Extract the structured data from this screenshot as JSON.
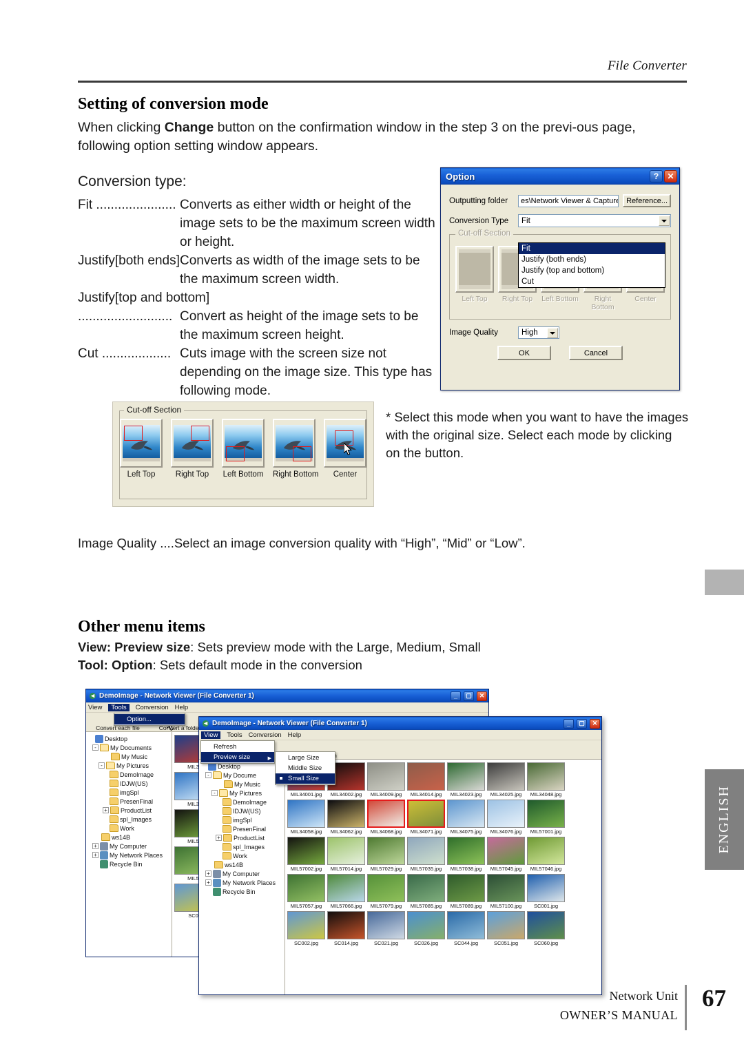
{
  "page": {
    "running_head": "File Converter",
    "footer_network": "Network Unit",
    "footer_manual": "OWNER’S MANUAL",
    "page_number": "67",
    "language_tab": "ENGLISH"
  },
  "section1": {
    "heading": "Setting of conversion mode",
    "intro_before": "When clicking ",
    "intro_bold": "Change",
    "intro_after": " button on the confirmation window in the step 3 on the previ-ous page, following option setting window appears.",
    "conversion_type_label": "Conversion type:",
    "entries": [
      {
        "term": "Fit ......................",
        "desc": "Converts as either width or height of the image  sets to be the maximum screen width or height."
      },
      {
        "term": "Justify[both ends]....",
        "desc": "Converts as width of the image sets to be the maximum screen width."
      },
      {
        "term": "Justify[top and bottom]",
        "desc": ""
      },
      {
        "term": " ..........................",
        "desc": "Convert as height of the image sets to be the maximum screen height."
      },
      {
        "term": "Cut ...................",
        "desc": "Cuts image with the screen size not depending on the image size. This type has following mode."
      }
    ],
    "note": "* Select this mode when you want to have the images with the original size. Select each mode by clicking on the button.",
    "image_quality_line": "Image Quality ....Select an image conversion quality with “High”, “Mid” or “Low”."
  },
  "section2": {
    "heading": "Other menu items",
    "line1_bold_a": "View: Preview size",
    "line1_rest": ": Sets preview mode with the Large, Medium, Small",
    "line2_bold_a": "Tool: Option",
    "line2_rest": ": Sets default mode in the conversion"
  },
  "option_dialog": {
    "title": "Option",
    "help_glyph": "?",
    "close_glyph": "✕",
    "output_folder_label": "Outputting folder",
    "output_folder_value": "es\\Network Viewer & Capture",
    "reference_button": "Reference...",
    "conversion_type_label": "Conversion Type",
    "conversion_type_value": "Fit",
    "conversion_options": [
      "Fit",
      "Justify (both ends)",
      "Justify (top and bottom)",
      "Cut"
    ],
    "conversion_selected_index": 0,
    "cutoff_legend": "Cut-off Section",
    "cutoff_captions": [
      "Left Top",
      "Right Top",
      "Left Bottom",
      "Right Bottom",
      "Center"
    ],
    "image_quality_label": "Image Quality",
    "image_quality_value": "High",
    "image_quality_options": [
      "High",
      "Mid",
      "Low"
    ],
    "ok_button": "OK",
    "cancel_button": "Cancel"
  },
  "cutoff_panel": {
    "legend": "Cut-off Section",
    "captions": [
      "Left Top",
      "Right Top",
      "Left Bottom",
      "Right Bottom",
      "Center"
    ]
  },
  "back_window": {
    "title": "DemoImage - Network Viewer (File Converter 1)",
    "menus": [
      "View",
      "Tools",
      "Conversion",
      "Help"
    ],
    "active_menu": "Tools",
    "menu_popup": [
      "Option..."
    ],
    "toolbar_labels": [
      "Convert each file",
      "Convert a folder"
    ],
    "tree": [
      {
        "label": "Desktop",
        "indent": 0,
        "expander": "",
        "icon": "desktop-icon"
      },
      {
        "label": "My Documents",
        "indent": 1,
        "expander": "-",
        "icon": "folder-open-icon"
      },
      {
        "label": "My Music",
        "indent": 2,
        "expander": "",
        "icon": "folder-music-icon"
      },
      {
        "label": "My Pictures",
        "indent": 2,
        "expander": "-",
        "icon": "folder-pictures-icon"
      },
      {
        "label": "DemoImage",
        "indent": 3,
        "expander": "",
        "icon": "folder-icon"
      },
      {
        "label": "IDJW(US)",
        "indent": 3,
        "expander": "",
        "icon": "folder-icon"
      },
      {
        "label": "imgSpl",
        "indent": 3,
        "expander": "",
        "icon": "folder-icon"
      },
      {
        "label": "PresenFinal",
        "indent": 3,
        "expander": "",
        "icon": "folder-icon"
      },
      {
        "label": "ProductList",
        "indent": 3,
        "expander": "+",
        "icon": "folder-icon"
      },
      {
        "label": "spl_Images",
        "indent": 3,
        "expander": "",
        "icon": "folder-icon"
      },
      {
        "label": "Work",
        "indent": 3,
        "expander": "",
        "icon": "folder-icon"
      },
      {
        "label": "ws14B",
        "indent": 2,
        "expander": "",
        "icon": "folder-icon"
      },
      {
        "label": "My Computer",
        "indent": 1,
        "expander": "+",
        "icon": "computer-icon"
      },
      {
        "label": "My Network Places",
        "indent": 1,
        "expander": "+",
        "icon": "network-icon"
      },
      {
        "label": "Recycle Bin",
        "indent": 1,
        "expander": "",
        "icon": "recycle-bin-icon"
      }
    ],
    "edge_thumb_names": [
      "MIL3",
      "MIL3",
      "MIL5",
      "MIL5",
      "SC0"
    ]
  },
  "front_window": {
    "title": "DemoImage - Network Viewer (File Converter 1)",
    "menus": [
      "View",
      "Tools",
      "Conversion",
      "Help"
    ],
    "active_menu": "View",
    "view_menu": [
      {
        "label": "Refresh",
        "selected": false,
        "submenu": false
      },
      {
        "label": "Preview size",
        "selected": true,
        "submenu": true
      }
    ],
    "preview_submenu": [
      {
        "label": "Large Size",
        "checked": false
      },
      {
        "label": "Middle Size",
        "checked": false
      },
      {
        "label": "Small Size",
        "checked": true
      }
    ],
    "toolbar_labels": [
      "Refresh"
    ],
    "tree": [
      {
        "label": "Desktop",
        "indent": 0,
        "expander": "",
        "icon": "desktop-icon"
      },
      {
        "label": "My Docume",
        "indent": 1,
        "expander": "-",
        "icon": "folder-open-icon"
      },
      {
        "label": "My Music",
        "indent": 2,
        "expander": "",
        "icon": "folder-music-icon"
      },
      {
        "label": "My Pictures",
        "indent": 2,
        "expander": "-",
        "icon": "folder-pictures-icon"
      },
      {
        "label": "DemoImage",
        "indent": 3,
        "expander": "",
        "icon": "folder-icon"
      },
      {
        "label": "IDJW(US)",
        "indent": 3,
        "expander": "",
        "icon": "folder-icon"
      },
      {
        "label": "imgSpl",
        "indent": 3,
        "expander": "",
        "icon": "folder-icon"
      },
      {
        "label": "PresenFinal",
        "indent": 3,
        "expander": "",
        "icon": "folder-icon"
      },
      {
        "label": "ProductList",
        "indent": 3,
        "expander": "+",
        "icon": "folder-icon"
      },
      {
        "label": "spl_Images",
        "indent": 3,
        "expander": "",
        "icon": "folder-icon"
      },
      {
        "label": "Work",
        "indent": 3,
        "expander": "",
        "icon": "folder-icon"
      },
      {
        "label": "ws14B",
        "indent": 2,
        "expander": "",
        "icon": "folder-icon"
      },
      {
        "label": "My Computer",
        "indent": 1,
        "expander": "+",
        "icon": "computer-icon"
      },
      {
        "label": "My Network Places",
        "indent": 1,
        "expander": "+",
        "icon": "network-icon"
      },
      {
        "label": "Recycle Bin",
        "indent": 1,
        "expander": "",
        "icon": "recycle-bin-icon"
      }
    ],
    "thumbnail_rows": [
      [
        {
          "name": "MIL34001.jpg",
          "c1": "#1d3f8a",
          "c2": "#c23b2e",
          "selected": false
        },
        {
          "name": "MIL34002.jpg",
          "c1": "#0c0c0c",
          "c2": "#b6342c",
          "selected": false
        },
        {
          "name": "MIL34009.jpg",
          "c1": "#8e8f86",
          "c2": "#cfd0c6",
          "selected": false
        },
        {
          "name": "MIL34014.jpg",
          "c1": "#8e5c4a",
          "c2": "#c8624a",
          "selected": false
        },
        {
          "name": "MIL34023.jpg",
          "c1": "#2f6a33",
          "c2": "#d8d8d4",
          "selected": false
        },
        {
          "name": "MIL34025.jpg",
          "c1": "#3d3d3d",
          "c2": "#c7c4bb",
          "selected": false
        },
        {
          "name": "MIL34048.jpg",
          "c1": "#4a6a36",
          "c2": "#d9d4c2",
          "selected": false
        }
      ],
      [
        {
          "name": "MIL34058.jpg",
          "c1": "#2f74c4",
          "c2": "#cfe6f7",
          "selected": false
        },
        {
          "name": "MIL34062.jpg",
          "c1": "#0b0b0f",
          "c2": "#cdb56a",
          "selected": false
        },
        {
          "name": "MIL34068.jpg",
          "c1": "#d24a3a",
          "c2": "#f0efe9",
          "selected": true
        },
        {
          "name": "MIL34071.jpg",
          "c1": "#cdbe37",
          "c2": "#7e8e3a",
          "selected": true
        },
        {
          "name": "MIL34075.jpg",
          "c1": "#5d96cf",
          "c2": "#d8e7f2",
          "selected": false
        },
        {
          "name": "MIL34076.jpg",
          "c1": "#9dc2e4",
          "c2": "#e9f2fa",
          "selected": false
        },
        {
          "name": "MIL57001.jpg",
          "c1": "#1f5a2c",
          "c2": "#79b24a",
          "selected": false
        }
      ],
      [
        {
          "name": "MIL57002.jpg",
          "c1": "#131310",
          "c2": "#76a93e",
          "selected": false
        },
        {
          "name": "MIL57014.jpg",
          "c1": "#9cc36a",
          "c2": "#e6f0df",
          "selected": false
        },
        {
          "name": "MIL57029.jpg",
          "c1": "#4e7a31",
          "c2": "#bed79b",
          "selected": false
        },
        {
          "name": "MIL57035.jpg",
          "c1": "#8fa7bd",
          "c2": "#cfe0cd",
          "selected": false
        },
        {
          "name": "MIL57038.jpg",
          "c1": "#2f6e2b",
          "c2": "#8dc258",
          "selected": false
        },
        {
          "name": "MIL57045.jpg",
          "c1": "#c66a9c",
          "c2": "#5f9b3c",
          "selected": false
        },
        {
          "name": "MIL57046.jpg",
          "c1": "#6f9a34",
          "c2": "#d3e79d",
          "selected": false
        }
      ],
      [
        {
          "name": "MIL57057.jpg",
          "c1": "#3e7233",
          "c2": "#93c063",
          "selected": false
        },
        {
          "name": "MIL57066.jpg",
          "c1": "#4f8a3c",
          "c2": "#b9d7ea",
          "selected": false
        },
        {
          "name": "MIL57079.jpg",
          "c1": "#56913a",
          "c2": "#8fc05a",
          "selected": false
        },
        {
          "name": "MIL57085.jpg",
          "c1": "#3a6a4a",
          "c2": "#7fae7c",
          "selected": false
        },
        {
          "name": "MIL57089.jpg",
          "c1": "#2f5b2c",
          "c2": "#6d9a46",
          "selected": false
        },
        {
          "name": "MIL57100.jpg",
          "c1": "#2c4e36",
          "c2": "#69945a",
          "selected": false
        },
        {
          "name": "SC001.jpg",
          "c1": "#1f5fae",
          "c2": "#dfe7ea",
          "selected": false
        }
      ],
      [
        {
          "name": "SC002.jpg",
          "c1": "#5f97d4",
          "c2": "#cdc743",
          "selected": false
        },
        {
          "name": "SC014.jpg",
          "c1": "#120d0d",
          "c2": "#c6542a",
          "selected": false
        },
        {
          "name": "SC021.jpg",
          "c1": "#47699a",
          "c2": "#cfd9e4",
          "selected": false
        },
        {
          "name": "SC026.jpg",
          "c1": "#4b8fd0",
          "c2": "#86b06a",
          "selected": false
        },
        {
          "name": "SC044.jpg",
          "c1": "#2a6aa8",
          "c2": "#8fbcd8",
          "selected": false
        },
        {
          "name": "SC051.jpg",
          "c1": "#5ba0dc",
          "c2": "#caa86a",
          "selected": false
        },
        {
          "name": "SC060.jpg",
          "c1": "#1f4f9e",
          "c2": "#5f8f4a",
          "selected": false
        }
      ]
    ]
  },
  "colors": {
    "xp_title_blue": "#0a4bbd",
    "dialog_face": "#ece9d8",
    "selection_blue": "#0a246a",
    "red_marquee": "#e01b1b",
    "lang_tab_grey": "#808080"
  }
}
